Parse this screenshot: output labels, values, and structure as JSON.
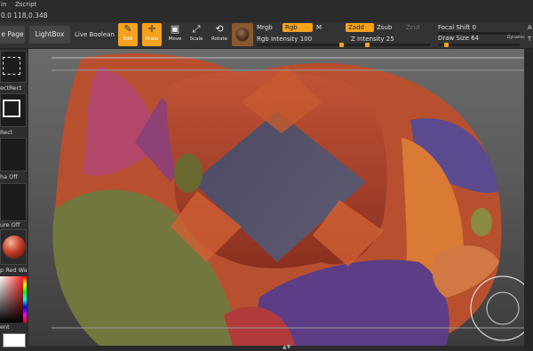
{
  "menu": {
    "items": [
      "in",
      "Zscript"
    ]
  },
  "coords_readout": "0.0 118,0.348",
  "toolbar": {
    "home_page_label": "e Page",
    "lightbox_label": "LightBox",
    "live_boolean_label": "Live Boolean",
    "tools": [
      {
        "label": "Edit",
        "active": true
      },
      {
        "label": "Draw",
        "active": true
      },
      {
        "label": "Move",
        "active": false
      },
      {
        "label": "Scale",
        "active": false
      },
      {
        "label": "Rotate",
        "active": false
      }
    ],
    "mrgb_label": "Mrgb",
    "rgb_label": "Rgb",
    "m_label": "M",
    "rgb_intensity_label": "Rgb Intensity",
    "rgb_intensity_value": "100",
    "zadd_label": "Zadd",
    "zsub_label": "Zsub",
    "zcut_label": "Zcut",
    "z_intensity_label": "Z Intensity",
    "z_intensity_value": "25",
    "focal_shift_label": "Focal Shift",
    "focal_shift_value": "0",
    "draw_size_label": "Draw Size",
    "draw_size_value": "64",
    "dynamic_label": "Dynamic",
    "right_edge_labels": [
      "A",
      "T"
    ],
    "rgb_intensity_fraction": 1.0,
    "z_intensity_fraction": 0.25,
    "draw_size_fraction": 0.1
  },
  "left_shelf": {
    "brush_label": "ectRect",
    "stroke_label": "Rect",
    "alpha_label": "ha Off",
    "texture_label": "ure Off",
    "material_label": "p Red Wa",
    "gradient_label": "ent"
  },
  "colors": {
    "accent": "#f6a21e",
    "toolbar_bg": "#333333",
    "canvas_bg": "#5c5c5c"
  },
  "icons": {
    "edit": "edit-icon",
    "draw": "draw-icon",
    "move": "move-icon",
    "scale": "scale-icon",
    "rotate": "rotate-icon",
    "material": "material-sphere-icon",
    "navigation": "navigation-circle-icon"
  }
}
